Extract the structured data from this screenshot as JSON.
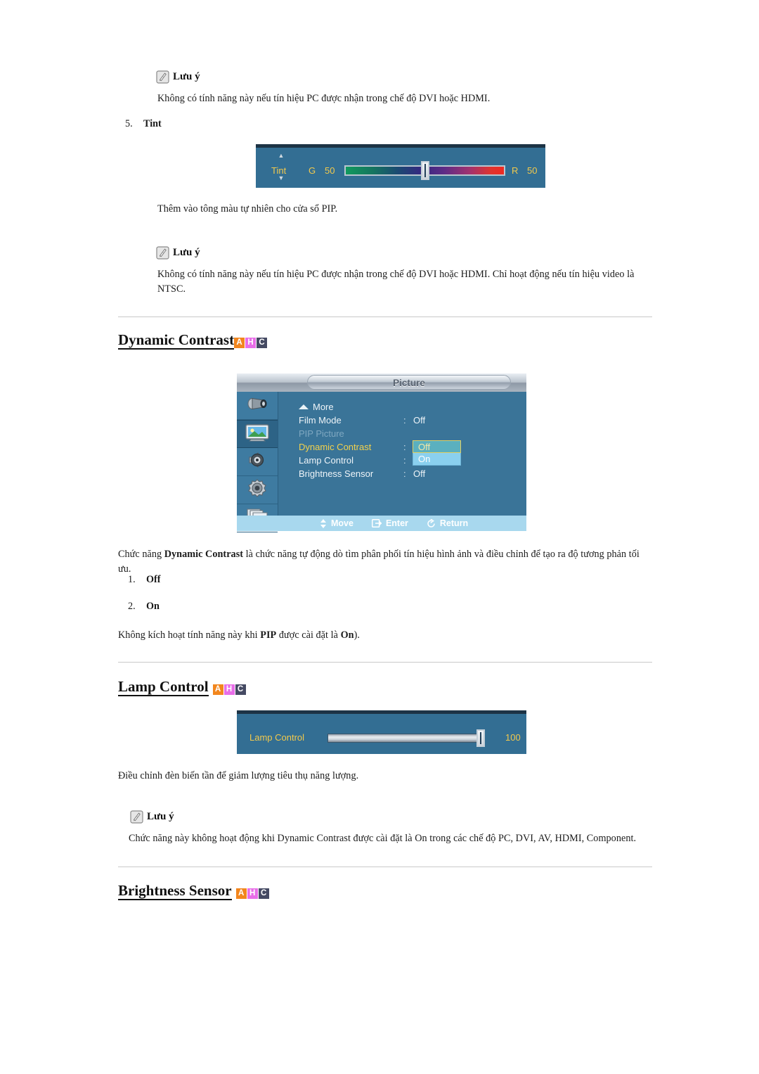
{
  "notes": {
    "label": "Lưu ý",
    "note1": "Không có tính năng này nếu tín hiệu PC được nhận trong chế độ DVI hoặc HDMI.",
    "note2": "Không có tính năng này nếu tín hiệu PC được nhận trong chế độ DVI hoặc HDMI. Chỉ hoạt động nếu tín hiệu video là NTSC.",
    "note3": "Chức năng này không hoạt động khi Dynamic Contrast được cài đặt là On trong các chế độ PC, DVI, AV, HDMI, Component."
  },
  "tint_item": {
    "number": "5.",
    "title": "Tint",
    "description": "Thêm vào tông màu tự nhiên cho cửa sổ PIP."
  },
  "tint_widget": {
    "label": "Tint",
    "left_letter": "G",
    "left_value": "50",
    "right_letter": "R",
    "right_value": "50",
    "slider_percent": 50,
    "up_arrow": "▲",
    "down_arrow": "▼"
  },
  "dynamic_contrast": {
    "heading": "Dynamic Contrast",
    "badges": [
      "A",
      "H",
      "C"
    ],
    "description_pre": "Chức năng ",
    "description_bold": "Dynamic Contrast",
    "description_post": " là chức năng tự động dò tìm phân phối tín hiệu hình ảnh và điều chỉnh để tạo ra độ tương phản tối ưu.",
    "options": [
      {
        "num": "1.",
        "label": "Off"
      },
      {
        "num": "2.",
        "label": "On"
      }
    ],
    "footnote_pre": "Không kích hoạt tính năng này khi ",
    "footnote_b1": "PIP",
    "footnote_mid": " được cài đặt là ",
    "footnote_b2": "On",
    "footnote_post": ")."
  },
  "osd_menu": {
    "title": "Picture",
    "sidebar_icons": [
      "input-source-icon",
      "picture-icon",
      "sound-icon",
      "setup-gear-icon",
      "multi-control-icon"
    ],
    "selected_sidebar_index": 1,
    "rows": [
      {
        "label": "More",
        "colon": "",
        "value": "",
        "state": "more"
      },
      {
        "label": "Film Mode",
        "colon": ":",
        "value": "Off",
        "state": "normal"
      },
      {
        "label": "PIP Picture",
        "colon": "",
        "value": "",
        "state": "disabled"
      },
      {
        "label": "Dynamic Contrast",
        "colon": ":",
        "value": "",
        "state": "active"
      },
      {
        "label": "Lamp Control",
        "colon": ":",
        "value": "",
        "state": "normal"
      },
      {
        "label": "Brightness Sensor",
        "colon": ":",
        "value": "Off",
        "state": "normal"
      }
    ],
    "dropdown": {
      "selected": "Off",
      "other": "On"
    },
    "footer": [
      {
        "icon": "move-updown-icon",
        "label": "Move"
      },
      {
        "icon": "enter-icon",
        "label": "Enter"
      },
      {
        "icon": "return-icon",
        "label": "Return"
      }
    ]
  },
  "lamp_control": {
    "heading": "Lamp Control",
    "badges": [
      "A",
      "H",
      "C"
    ],
    "widget_label": "Lamp Control",
    "widget_value": "100",
    "slider_percent": 100,
    "description": "Điều chỉnh đèn biến tần để giảm lượng tiêu thụ năng lượng."
  },
  "brightness_sensor": {
    "heading": "Brightness Sensor",
    "badges": [
      "A",
      "H",
      "C"
    ]
  },
  "colors": {
    "badge_a": "#f2861e",
    "badge_h": "#e86ee8",
    "badge_c": "#454a63",
    "osd_bg": "#3a7498",
    "osd_label_yellow": "#f2c94c",
    "osd_footer": "#a8d8ee"
  }
}
